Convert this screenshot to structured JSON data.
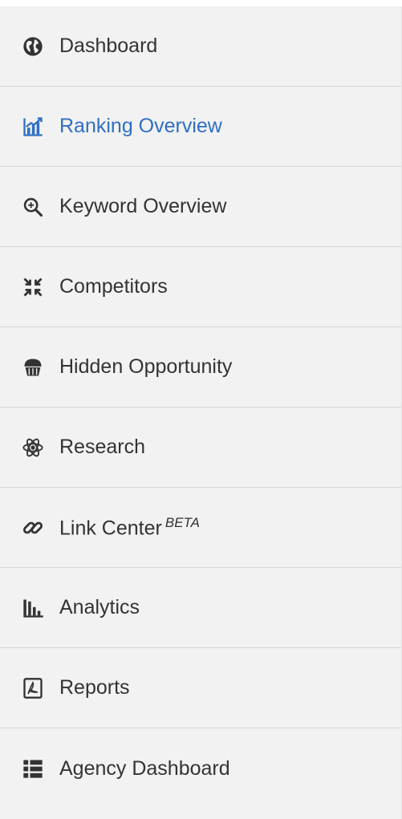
{
  "sidebar": {
    "active_color": "#2f6fc4",
    "items": [
      {
        "label": "Dashboard",
        "icon": "globe-icon"
      },
      {
        "label": "Ranking Overview",
        "icon": "ranking-chart-icon",
        "active": true
      },
      {
        "label": "Keyword Overview",
        "icon": "search-icon"
      },
      {
        "label": "Competitors",
        "icon": "compress-arrows-icon"
      },
      {
        "label": "Hidden Opportunity",
        "icon": "cupcake-icon"
      },
      {
        "label": "Research",
        "icon": "atom-icon"
      },
      {
        "label": "Link Center",
        "badge": "BETA",
        "icon": "link-icon"
      },
      {
        "label": "Analytics",
        "icon": "bar-chart-icon"
      },
      {
        "label": "Reports",
        "icon": "pdf-icon"
      },
      {
        "label": "Agency Dashboard",
        "icon": "list-icon"
      }
    ]
  }
}
